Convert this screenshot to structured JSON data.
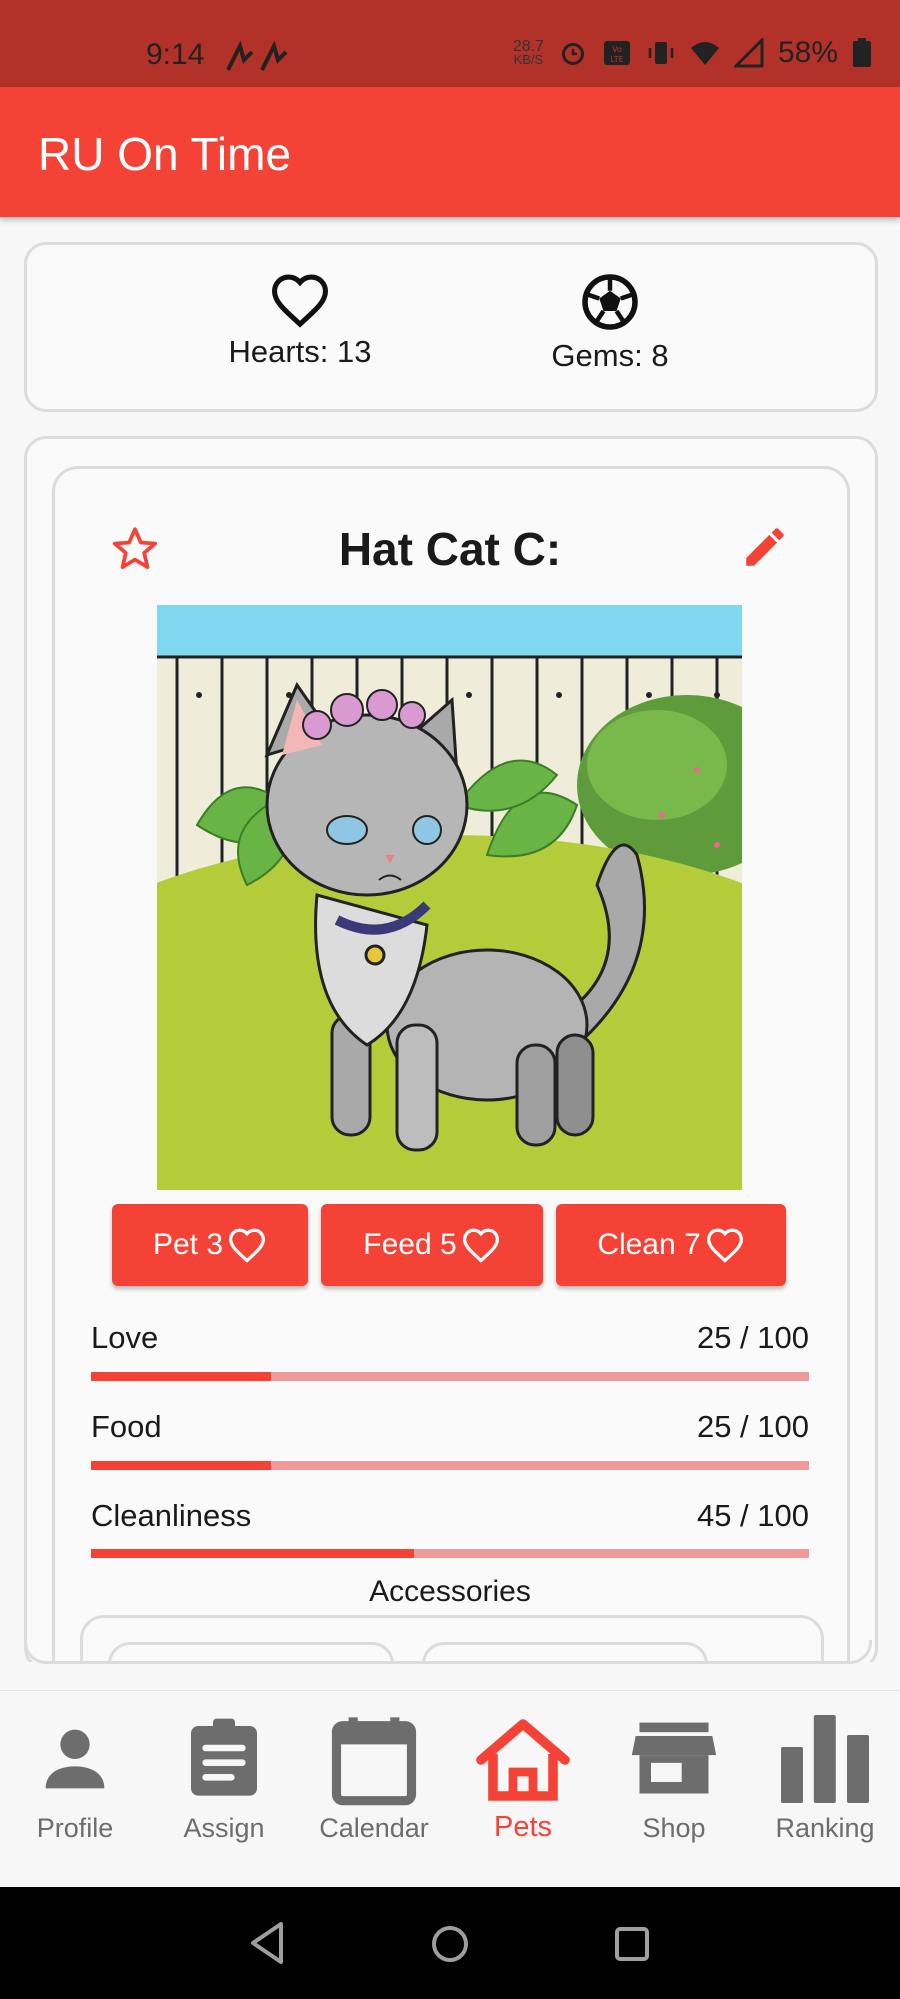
{
  "status_bar": {
    "time": "9:14",
    "kbs_top": "28.7",
    "kbs_bottom": "KB/S",
    "battery": "58%"
  },
  "app": {
    "title": "RU On Time",
    "accent": "#f44336"
  },
  "currency": {
    "hearts_label": "Hearts: 13",
    "gems_label": "Gems: 8"
  },
  "pet": {
    "name": "Hat Cat C:",
    "actions": [
      {
        "label": "Pet 3"
      },
      {
        "label": "Feed 5"
      },
      {
        "label": "Clean 7"
      }
    ],
    "stats": [
      {
        "label": "Love",
        "value": "25 / 100",
        "fraction": 0.25
      },
      {
        "label": "Food",
        "value": "25 / 100",
        "fraction": 0.25
      },
      {
        "label": "Cleanliness",
        "value": "45 / 100",
        "fraction": 0.45
      }
    ],
    "accessories_title": "Accessories"
  },
  "nav": {
    "items": [
      {
        "label": "Profile",
        "icon": "person-icon"
      },
      {
        "label": "Assign",
        "icon": "clipboard-icon"
      },
      {
        "label": "Calendar",
        "icon": "calendar-icon"
      },
      {
        "label": "Pets",
        "icon": "house-icon",
        "active": true
      },
      {
        "label": "Shop",
        "icon": "store-icon"
      },
      {
        "label": "Ranking",
        "icon": "bar-chart-icon"
      }
    ]
  }
}
